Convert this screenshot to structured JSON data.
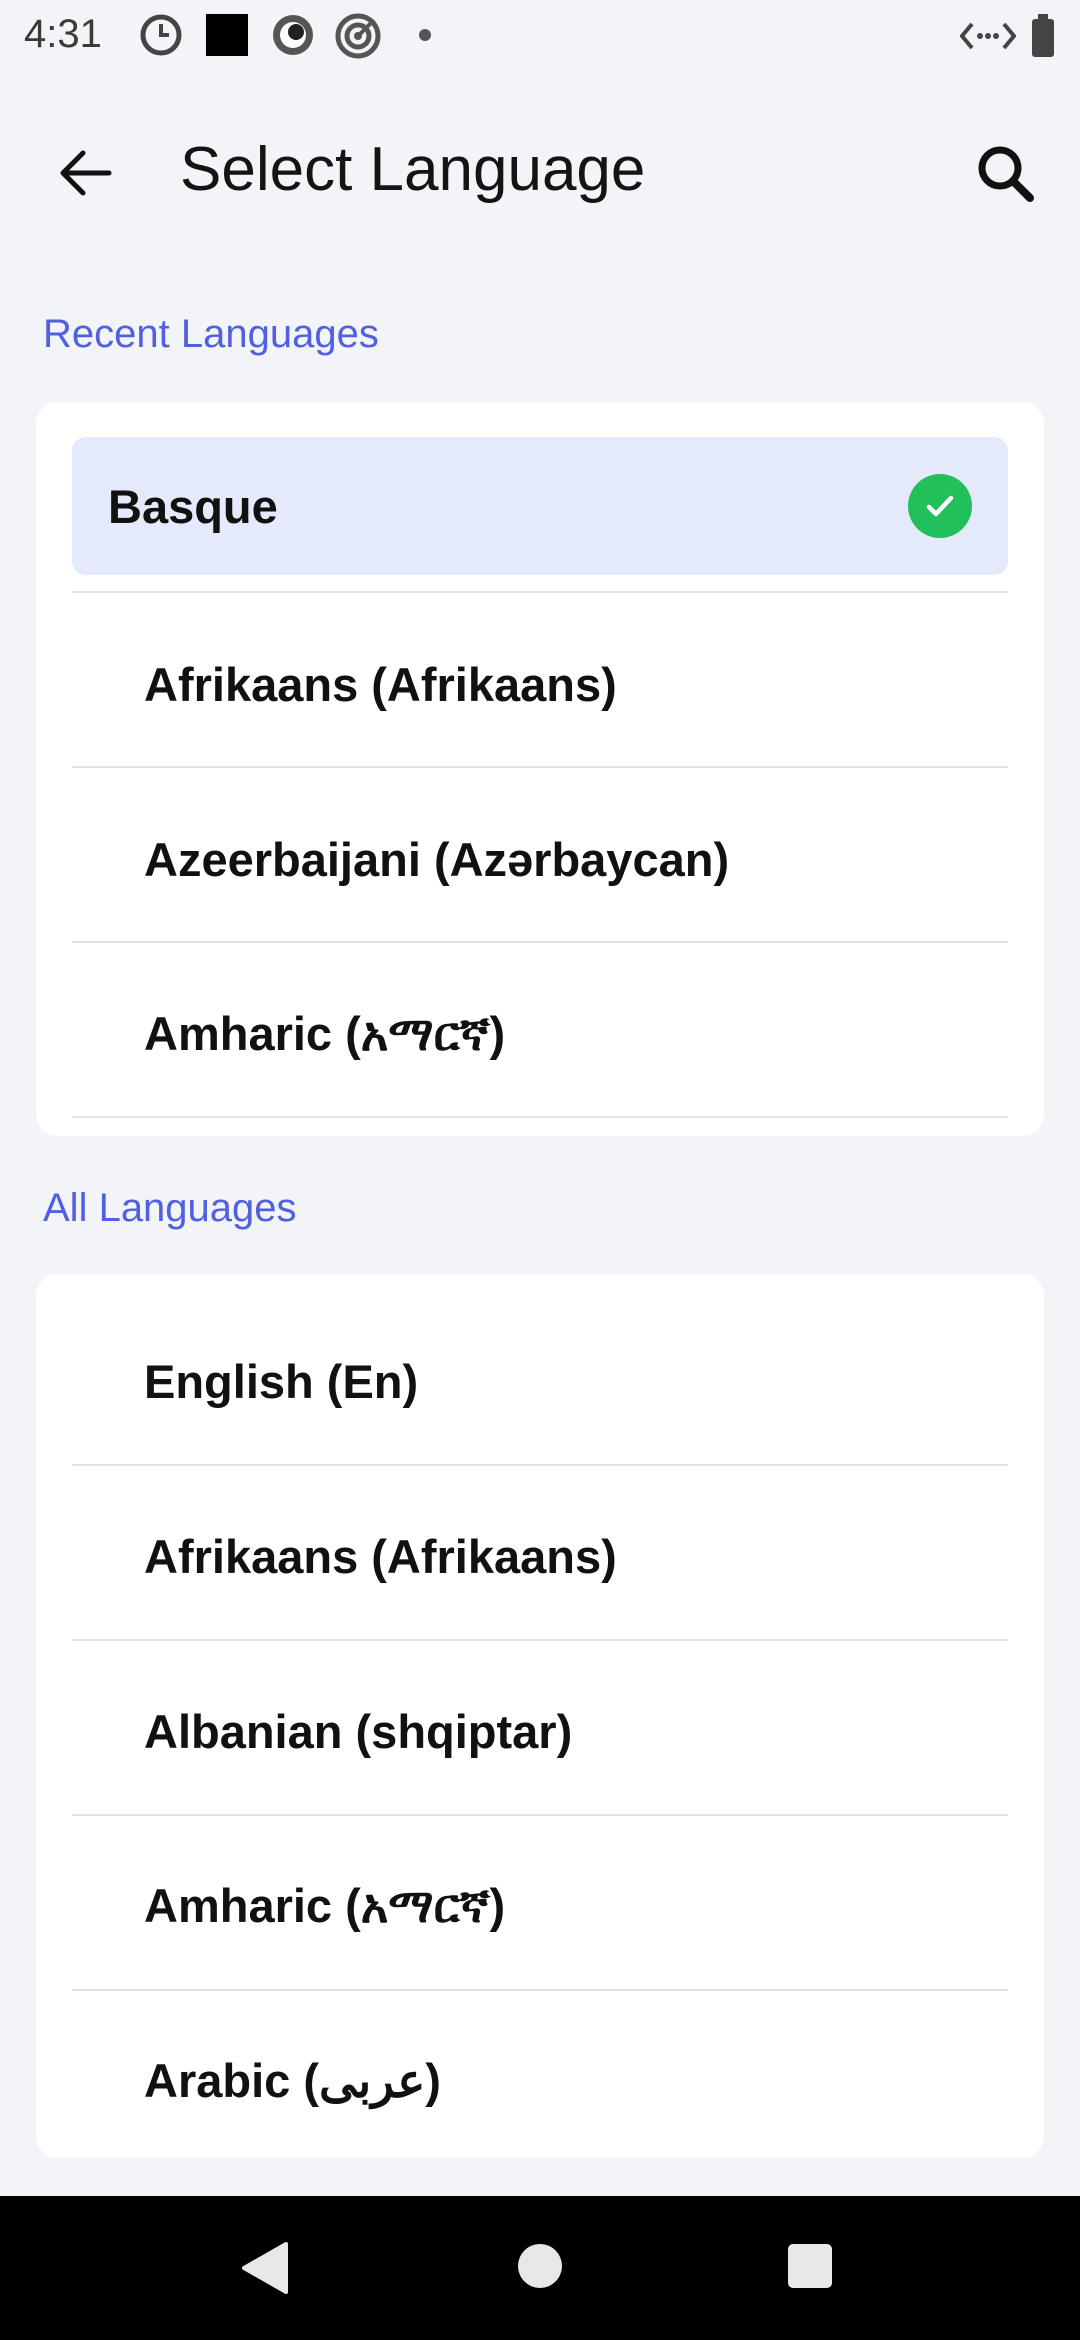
{
  "status_bar": {
    "time": "4:31",
    "icons": [
      "dnd-moon-icon",
      "square-app-icon",
      "record-icon",
      "target-icon",
      "dot-icon",
      "network-icon",
      "battery-icon"
    ]
  },
  "header": {
    "title": "Select Language",
    "back_icon": "arrow-left-icon",
    "search_icon": "search-icon"
  },
  "recent": {
    "header": "Recent Languages",
    "items": [
      {
        "label": "Basque",
        "selected": true
      },
      {
        "label": "Afrikaans (Afrikaans)"
      },
      {
        "label": "Azeerbaijani (Azərbaycan)"
      },
      {
        "label": "Amharic (አማርኛ)"
      }
    ]
  },
  "all": {
    "header": "All Languages",
    "items": [
      {
        "label": "English (En)"
      },
      {
        "label": "Afrikaans (Afrikaans)"
      },
      {
        "label": "Albanian (shqiptar)"
      },
      {
        "label": "Amharic (አማርኛ)"
      },
      {
        "label": "Arabic (عربى)"
      }
    ]
  },
  "colors": {
    "accent": "#5160e0",
    "selected_bg": "#e4e9fc",
    "check": "#22c05b",
    "background": "#f3f4f8"
  }
}
